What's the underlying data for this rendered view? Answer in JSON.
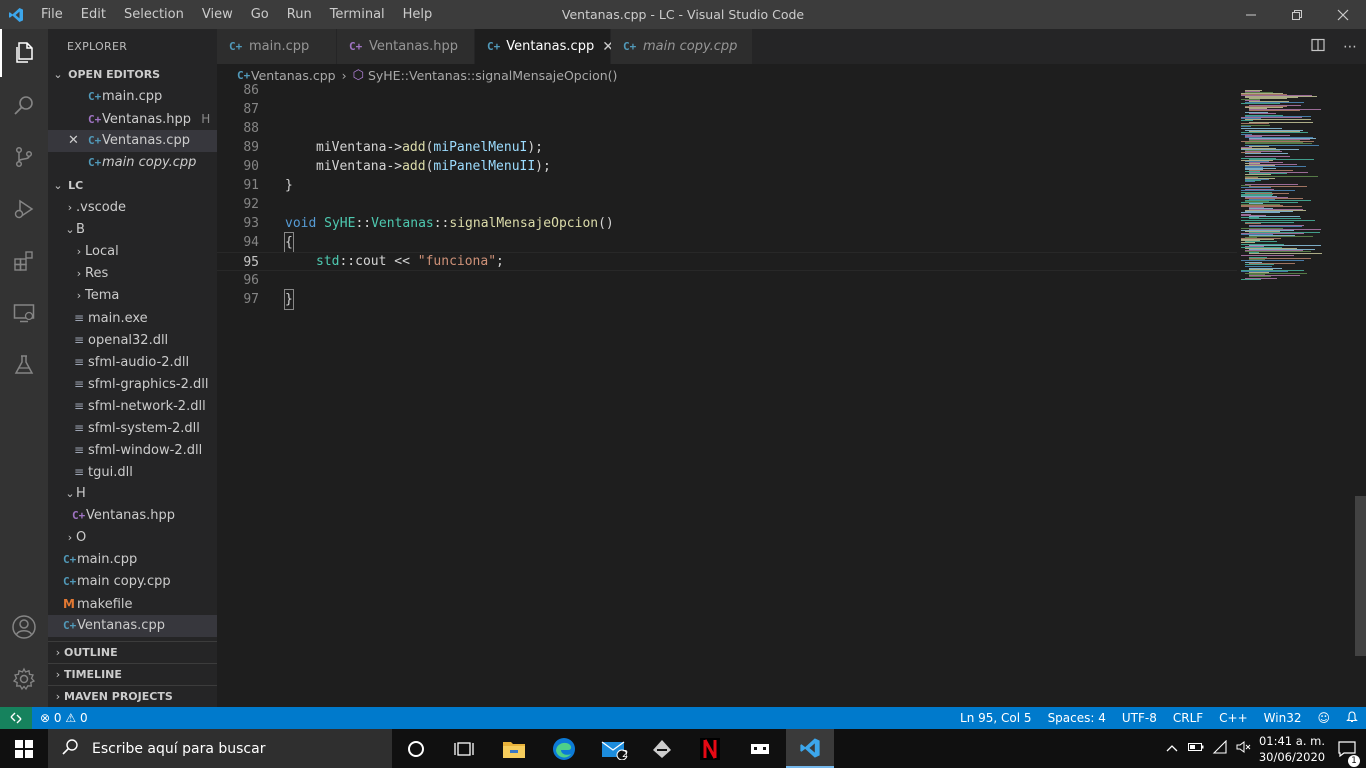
{
  "app": {
    "window_title": "Ventanas.cpp - LC - Visual Studio Code",
    "menu": [
      "File",
      "Edit",
      "Selection",
      "View",
      "Go",
      "Run",
      "Terminal",
      "Help"
    ]
  },
  "sidebar": {
    "title": "EXPLORER",
    "open_editors": {
      "label": "OPEN EDITORS",
      "items": [
        {
          "name": "main.cpp",
          "badge": ""
        },
        {
          "name": "Ventanas.hpp",
          "badge": "H"
        },
        {
          "name": "Ventanas.cpp",
          "badge": ""
        },
        {
          "name": "main copy.cpp",
          "badge": ""
        }
      ]
    },
    "workspace": {
      "label": "LC",
      "items": [
        {
          "name": ".vscode"
        },
        {
          "name": "B"
        },
        {
          "name": "Local"
        },
        {
          "name": "Res"
        },
        {
          "name": "Tema"
        },
        {
          "name": "main.exe"
        },
        {
          "name": "openal32.dll"
        },
        {
          "name": "sfml-audio-2.dll"
        },
        {
          "name": "sfml-graphics-2.dll"
        },
        {
          "name": "sfml-network-2.dll"
        },
        {
          "name": "sfml-system-2.dll"
        },
        {
          "name": "sfml-window-2.dll"
        },
        {
          "name": "tgui.dll"
        },
        {
          "name": "H"
        },
        {
          "name": "Ventanas.hpp"
        },
        {
          "name": "O"
        },
        {
          "name": "main.cpp"
        },
        {
          "name": "main copy.cpp"
        },
        {
          "name": "makefile"
        },
        {
          "name": "Ventanas.cpp"
        }
      ]
    },
    "sections": [
      "OUTLINE",
      "TIMELINE",
      "MAVEN PROJECTS"
    ]
  },
  "tabs": [
    {
      "label": "main.cpp",
      "close": ""
    },
    {
      "label": "Ventanas.hpp",
      "close": ""
    },
    {
      "label": "Ventanas.cpp",
      "close": "✕"
    },
    {
      "label": "main copy.cpp",
      "close": ""
    }
  ],
  "breadcrumb": {
    "file": "Ventanas.cpp",
    "symbol": "SyHE::Ventanas::signalMensajeOpcion()"
  },
  "editor": {
    "line_numbers": [
      "86",
      "87",
      "88",
      "89",
      "90",
      "91",
      "92",
      "93",
      "94",
      "95",
      "96",
      "97"
    ],
    "code": {
      "l88_obj": "miVentana",
      "l88_arrow": "->",
      "l88_fn": "add",
      "l88_arg": "miPanelMenuI",
      "l88_end": ");",
      "l89_obj": "miVentana",
      "l89_arrow": "->",
      "l89_fn": "add",
      "l89_arg": "miPanelMenuII",
      "l89_end": ");",
      "l90": "}",
      "l92_void": "void",
      "l92_ns": "SyHE",
      "l92_sep1": "::",
      "l92_cls": "Ventanas",
      "l92_sep2": "::",
      "l92_fn": "signalMensajeOpcion",
      "l92_par": "()",
      "l93": "{",
      "l94_ns": "std",
      "l94_sep": "::",
      "l94_cout": "cout",
      "l94_op": " << ",
      "l94_str": "\"funciona\"",
      "l94_end": ";",
      "l96": "}"
    }
  },
  "statusbar": {
    "errors": "0",
    "warnings": "0",
    "position": "Ln 95, Col 5",
    "spaces": "Spaces: 4",
    "encoding": "UTF-8",
    "eol": "CRLF",
    "language": "C++",
    "platform": "Win32"
  },
  "taskbar": {
    "search_placeholder": "Escribe aquí para buscar",
    "mail_badge": "2",
    "time": "01:41 a. m.",
    "date": "30/06/2020",
    "notification_count": "1"
  },
  "colors": {
    "accent": "#007acc",
    "remote": "#16825d",
    "cpp_icon": "#519aba",
    "hpp_icon": "#a074c4"
  }
}
